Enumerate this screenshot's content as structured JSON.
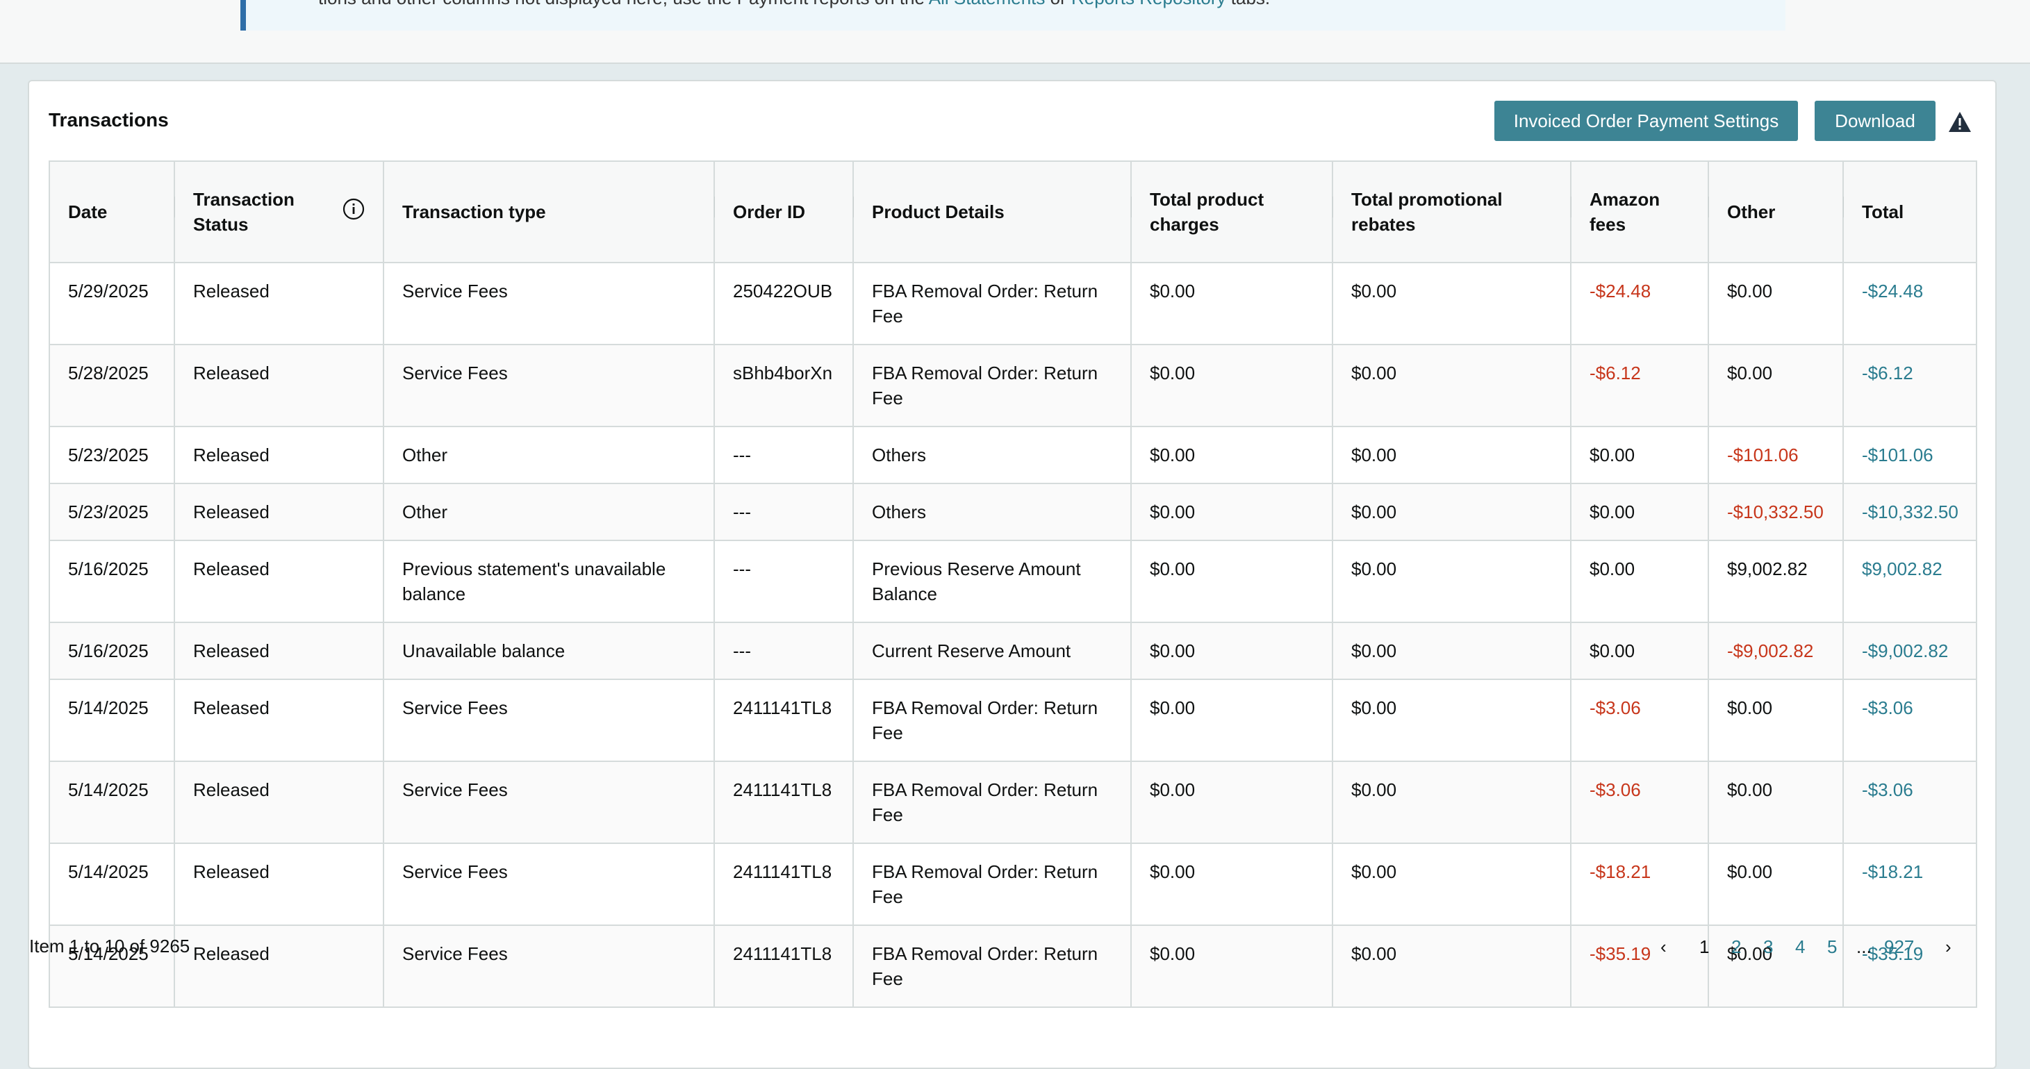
{
  "notice": {
    "text_before": "tions and other columns not displayed here, use the Payment reports on the ",
    "link1": "All Statements",
    "text_mid": " or ",
    "link2": "Reports Repository",
    "text_after": " tabs."
  },
  "card": {
    "title": "Transactions",
    "settings_button": "Invoiced Order Payment Settings",
    "download_button": "Download",
    "warning_icon": "warning-triangle-icon"
  },
  "table": {
    "headers": {
      "date": "Date",
      "status_l1": "Transaction",
      "status_l2": "Status",
      "type": "Transaction type",
      "order_id": "Order ID",
      "product": "Product Details",
      "charges_l1": "Total product",
      "charges_l2": "charges",
      "rebates_l1": "Total promotional",
      "rebates_l2": "rebates",
      "fees_l1": "Amazon",
      "fees_l2": "fees",
      "other": "Other",
      "total": "Total"
    },
    "rows": [
      {
        "date": "5/29/2025",
        "status": "Released",
        "type": "Service Fees",
        "order_id": "250422OUB",
        "product": "FBA Removal Order: Return Fee",
        "charges": "$0.00",
        "rebates": "$0.00",
        "fees": "-$24.48",
        "other": "$0.00",
        "total": "-$24.48"
      },
      {
        "date": "5/28/2025",
        "status": "Released",
        "type": "Service Fees",
        "order_id": "sBhb4borXn",
        "product": "FBA Removal Order: Return Fee",
        "charges": "$0.00",
        "rebates": "$0.00",
        "fees": "-$6.12",
        "other": "$0.00",
        "total": "-$6.12"
      },
      {
        "date": "5/23/2025",
        "status": "Released",
        "type": "Other",
        "order_id": "---",
        "product": "Others",
        "charges": "$0.00",
        "rebates": "$0.00",
        "fees": "$0.00",
        "other": "-$101.06",
        "total": "-$101.06"
      },
      {
        "date": "5/23/2025",
        "status": "Released",
        "type": "Other",
        "order_id": "---",
        "product": "Others",
        "charges": "$0.00",
        "rebates": "$0.00",
        "fees": "$0.00",
        "other": "-$10,332.50",
        "total": "-$10,332.50"
      },
      {
        "date": "5/16/2025",
        "status": "Released",
        "type": "Previous statement's unavailable balance",
        "order_id": "---",
        "product": "Previous Reserve Amount Balance",
        "charges": "$0.00",
        "rebates": "$0.00",
        "fees": "$0.00",
        "other": "$9,002.82",
        "total": "$9,002.82"
      },
      {
        "date": "5/16/2025",
        "status": "Released",
        "type": "Unavailable balance",
        "order_id": "---",
        "product": "Current Reserve Amount",
        "charges": "$0.00",
        "rebates": "$0.00",
        "fees": "$0.00",
        "other": "-$9,002.82",
        "total": "-$9,002.82"
      },
      {
        "date": "5/14/2025",
        "status": "Released",
        "type": "Service Fees",
        "order_id": "2411141TL8",
        "product": "FBA Removal Order: Return Fee",
        "charges": "$0.00",
        "rebates": "$0.00",
        "fees": "-$3.06",
        "other": "$0.00",
        "total": "-$3.06"
      },
      {
        "date": "5/14/2025",
        "status": "Released",
        "type": "Service Fees",
        "order_id": "2411141TL8",
        "product": "FBA Removal Order: Return Fee",
        "charges": "$0.00",
        "rebates": "$0.00",
        "fees": "-$3.06",
        "other": "$0.00",
        "total": "-$3.06"
      },
      {
        "date": "5/14/2025",
        "status": "Released",
        "type": "Service Fees",
        "order_id": "2411141TL8",
        "product": "FBA Removal Order: Return Fee",
        "charges": "$0.00",
        "rebates": "$0.00",
        "fees": "-$18.21",
        "other": "$0.00",
        "total": "-$18.21"
      },
      {
        "date": "5/14/2025",
        "status": "Released",
        "type": "Service Fees",
        "order_id": "2411141TL8",
        "product": "FBA Removal Order: Return Fee",
        "charges": "$0.00",
        "rebates": "$0.00",
        "fees": "-$35.19",
        "other": "$0.00",
        "total": "-$35.19"
      }
    ]
  },
  "footer": {
    "item_count": "Item 1 to 10 of 9265",
    "pages": [
      "1",
      "2",
      "3",
      "4",
      "5",
      "...",
      "927"
    ]
  },
  "colors": {
    "accent": "#3d8494",
    "negative": "#c7361b",
    "total_text": "#2a7c8f"
  }
}
